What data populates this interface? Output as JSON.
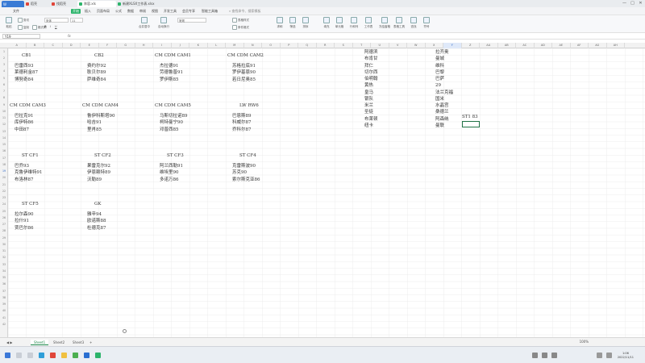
{
  "titlebar": {
    "tabs": [
      {
        "label": "稻壳",
        "color": "#e0463a"
      },
      {
        "label": "找稻壳",
        "color": "#e0463a"
      },
      {
        "label": "阵容.xls",
        "color": "#2db46b"
      },
      {
        "label": "新建XLSX工作表.xlsx",
        "color": "#2db46b"
      }
    ],
    "controls": [
      "—",
      "□",
      "✕"
    ]
  },
  "menubar": {
    "items": [
      "文件",
      "开始",
      "插入",
      "页面布局",
      "公式",
      "数据",
      "审阅",
      "视图",
      "开发工具",
      "会员专享",
      "智能工具箱"
    ],
    "active_index": 1,
    "search_label": "查找命令、搜索模板"
  },
  "ribbon": {
    "paste": "粘贴",
    "cut": "剪切",
    "copy": "复制",
    "format_painter": "格式刷",
    "font_name": "宋体",
    "font_size": "11",
    "merge": "合并居中",
    "wrap": "自动换行",
    "number_format": "常规",
    "cond_format": "条件格式",
    "table_style": "表格样式",
    "sum": "求和",
    "filter": "筛选",
    "sort": "排序",
    "fill": "填充",
    "cell": "单元格",
    "row_col": "行和列",
    "sheet": "工作表",
    "freeze": "冻结窗格",
    "table_tools": "表格工具",
    "find": "查找",
    "symbol": "符号"
  },
  "formulabar": {
    "name_box": "Y19",
    "fx": "fx",
    "content": ""
  },
  "columns": [
    "A",
    "B",
    "C",
    "D",
    "E",
    "F",
    "G",
    "H",
    "I",
    "J",
    "K",
    "L",
    "M",
    "N",
    "O",
    "P",
    "Q",
    "R",
    "S",
    "T",
    "U",
    "V",
    "W",
    "X",
    "Y",
    "Z",
    "AA",
    "AB",
    "AC",
    "AD",
    "AE",
    "AF",
    "AG",
    "AH"
  ],
  "selected_column": "Y",
  "rows": [
    "1",
    "2",
    "3",
    "4",
    "5",
    "6",
    "7",
    "8",
    "9",
    "10",
    "11",
    "12",
    "13",
    "14",
    "15",
    "16",
    "17",
    "18",
    "19",
    "20",
    "21",
    "22",
    "23",
    "24",
    "25",
    "26",
    "27",
    "28",
    "29",
    "30",
    "31",
    "32",
    "33",
    "34",
    "35",
    "36",
    "37",
    "38",
    "39",
    "40",
    "41",
    "42"
  ],
  "selected_row": "19",
  "groups": [
    {
      "title": "CB1",
      "players": [
        "巴雷西93",
        "莱德利金87",
        "博努奇84"
      ]
    },
    {
      "title": "CB2",
      "players": [
        "费约尔92",
        "耿贝尔89",
        "萨维奇84"
      ]
    },
    {
      "title": "CM CDM CAM1",
      "players": [
        "杰拉德91",
        "劳德鲁普91",
        "罗伊斯85"
      ]
    },
    {
      "title": "CM CDM CAM2",
      "players": [
        "苏格拉底91",
        "罗伊基恩90",
        "若日尼奥85"
      ]
    },
    {
      "title": "CM CDM CAM3",
      "players": [
        "巴拉克91",
        "库伊特86",
        "中田87"
      ]
    },
    {
      "title": "CM CDM CAM4",
      "players": [
        "鲁伊科斯塔90",
        "哈吉91",
        "里肖85"
      ]
    },
    {
      "title": "CM CDM CAM5",
      "players": [
        "马斯切拉诺89",
        "柯特曼宁90",
        "邓普西85"
      ]
    },
    {
      "title": "LW RW6",
      "players": [
        "巴恩斯89",
        "科威尔87",
        "乔科尔87"
      ]
    },
    {
      "title": "ST CF1",
      "players": [
        "巴乔93",
        "克鲁伊维特91",
        "布洛林87"
      ]
    },
    {
      "title": "ST CF2",
      "players": [
        "果雷克尔92",
        "伊恩赖特89",
        "沃勒89"
      ]
    },
    {
      "title": "ST CF3",
      "players": [
        "阿兰西勒91",
        "维埃里90",
        "多诺万86"
      ]
    },
    {
      "title": "ST CF4",
      "players": [
        "克雷斯波90",
        "苏克90",
        "索尔斯克亚86"
      ]
    },
    {
      "title": "ST CF5",
      "players": [
        "拉尔森90",
        "拉什91",
        "贾巴尔86"
      ]
    },
    {
      "title": "GK",
      "players": [
        "雅辛94",
        "欧诺斯88",
        "杜德克87"
      ]
    }
  ],
  "list_col1": [
    "阿德滨",
    "布肯甘",
    "拜仁",
    "切尔西",
    "伯明翰",
    "黄热",
    "皇马",
    "银队",
    "米兰",
    "圣徒",
    "布莱顿",
    "纽卡"
  ],
  "list_col2": [
    "拉齐奥",
    "曼城",
    "维科",
    "巴黎",
    "巴萨",
    "29",
    "法兰克福",
    "国米",
    "水晶宫",
    "桑德兰",
    "阿森纳",
    "曼联"
  ],
  "extra_cell": "ST1 83",
  "sheets": [
    "Sheet1",
    "Sheet2",
    "Sheet3"
  ],
  "active_sheet": 0,
  "zoom": "100%",
  "clock": {
    "time": "1:06",
    "date": "2022/11/11"
  }
}
